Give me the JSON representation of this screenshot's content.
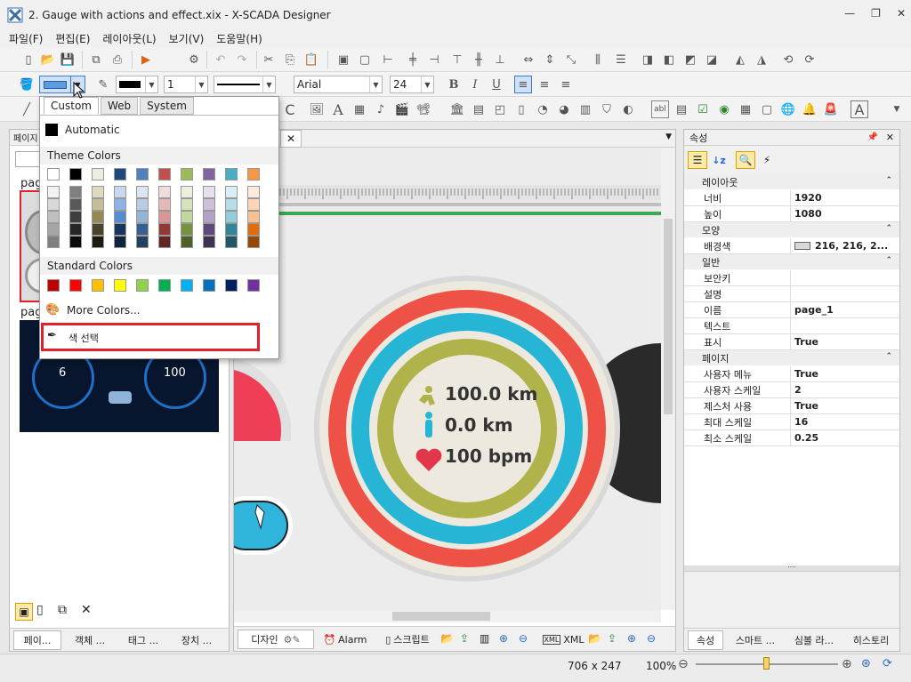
{
  "window": {
    "title": "2. Gauge with actions and effect.xix - X-SCADA Designer"
  },
  "menu": [
    "파일(F)",
    "편집(E)",
    "레이아웃(L)",
    "보기(V)",
    "도움말(H)"
  ],
  "toolbar1": {
    "run_label": "실행"
  },
  "toolbar2": {
    "line_width": "1",
    "font_name": "Arial",
    "font_size": "24"
  },
  "left_panel": {
    "header": "페이지",
    "page_label_1": "pag",
    "page_label_2": "pag",
    "thumb_values": [
      "6",
      "100"
    ],
    "tabs": [
      "페이...",
      "객체 ...",
      "태그 ...",
      "장치 ..."
    ]
  },
  "color_popup": {
    "tabs": [
      "Custom",
      "Web",
      "System"
    ],
    "automatic": "Automatic",
    "theme_title": "Theme Colors",
    "standard_title": "Standard Colors",
    "more_colors": "More Colors...",
    "pick_color": "색 선택",
    "theme_top": [
      "#ffffff",
      "#000000",
      "#eeece1",
      "#1f497d",
      "#4f81bd",
      "#c0504d",
      "#9bbb59",
      "#8064a2",
      "#4bacc6",
      "#f79646"
    ],
    "theme_shades": [
      [
        "#f2f2f2",
        "#d8d8d8",
        "#bfbfbf",
        "#a5a5a5",
        "#7f7f7f"
      ],
      [
        "#7f7f7f",
        "#595959",
        "#3f3f3f",
        "#262626",
        "#0c0c0c"
      ],
      [
        "#ddd9c3",
        "#c4bd97",
        "#938953",
        "#494429",
        "#1d1b10"
      ],
      [
        "#c6d9f0",
        "#8db3e2",
        "#548dd4",
        "#17365d",
        "#0f243e"
      ],
      [
        "#dbe5f1",
        "#b8cce4",
        "#95b3d7",
        "#366092",
        "#244061"
      ],
      [
        "#f2dcdb",
        "#e5b9b7",
        "#d99694",
        "#953734",
        "#632423"
      ],
      [
        "#ebf1dd",
        "#d7e3bc",
        "#c3d69b",
        "#76923c",
        "#4f6128"
      ],
      [
        "#e5e0ec",
        "#ccc1d9",
        "#b2a2c7",
        "#5f497a",
        "#3f3151"
      ],
      [
        "#dbeef3",
        "#b7dde8",
        "#92cddc",
        "#31859b",
        "#205867"
      ],
      [
        "#fdeada",
        "#fbd5b5",
        "#fac08f",
        "#e36c09",
        "#974806"
      ]
    ],
    "standard": [
      "#c00000",
      "#ff0000",
      "#ffc000",
      "#ffff00",
      "#92d050",
      "#00b050",
      "#00b0f0",
      "#0070c0",
      "#002060",
      "#7030a0"
    ]
  },
  "canvas": {
    "gauge_values": [
      "100.0 km",
      "0.0 km",
      "100 bpm"
    ],
    "tabs": [
      "디자인",
      "Alarm",
      "스크립트",
      "XML"
    ]
  },
  "properties": {
    "header": "속성",
    "groups": [
      {
        "name": "레이아웃",
        "rows": [
          [
            "너비",
            "1920"
          ],
          [
            "높이",
            "1080"
          ]
        ]
      },
      {
        "name": "모양",
        "rows": [
          [
            "배경색",
            "216, 216, 2..."
          ]
        ]
      },
      {
        "name": "일반",
        "rows": [
          [
            "보안키",
            ""
          ],
          [
            "설명",
            ""
          ],
          [
            "이름",
            "page_1"
          ],
          [
            "텍스트",
            ""
          ],
          [
            "표시",
            "True"
          ]
        ]
      },
      {
        "name": "페이지",
        "rows": [
          [
            "사용자 메뉴",
            "True"
          ],
          [
            "사용자 스케일",
            "2"
          ],
          [
            "제스처 사용",
            "True"
          ],
          [
            "최대 스케일",
            "16"
          ],
          [
            "최소 스케일",
            "0.25"
          ]
        ]
      }
    ],
    "tabs": [
      "속성",
      "스마트 ...",
      "심볼 라...",
      "히스토리"
    ]
  },
  "status": {
    "coords": "706 x 247",
    "zoom": "100%"
  },
  "colors": {
    "accent_red": "#e0202c",
    "ring_red": "#ee5145",
    "ring_blue": "#27b5d6",
    "ring_olive": "#b0b24a",
    "gauge_bg": "#eee9df"
  }
}
